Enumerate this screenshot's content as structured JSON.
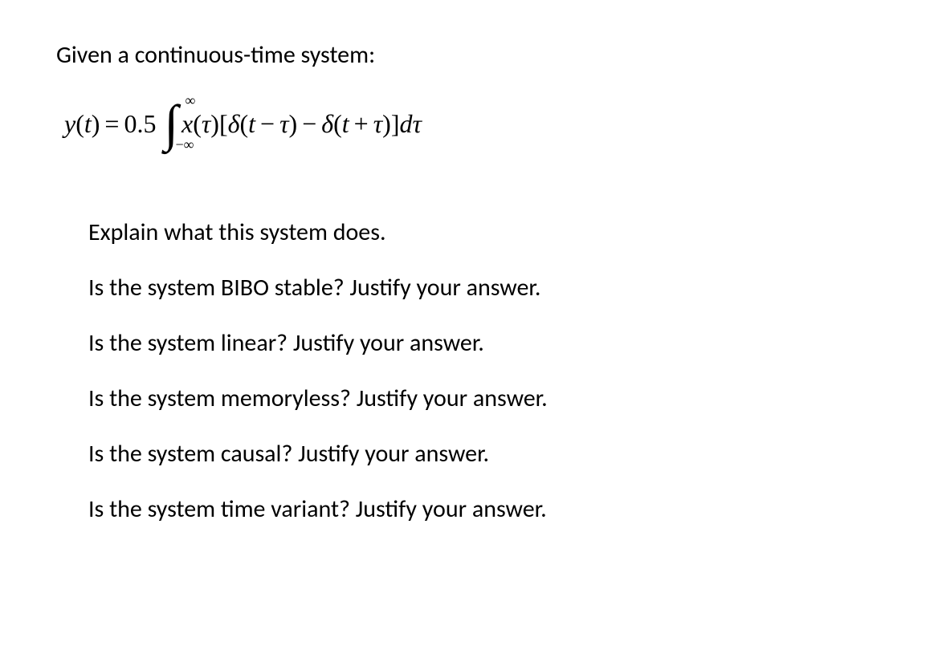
{
  "intro": "Given a continuous-time system:",
  "equation": {
    "lhs_y": "y",
    "lhs_t": "t",
    "equals": "=",
    "coeff": "0.5",
    "int_upper": "∞",
    "int_lower": "−∞",
    "x": "x",
    "tau1": "τ",
    "delta1": "δ",
    "t1": "t",
    "minus": "−",
    "tau2": "τ",
    "delta2": "δ",
    "t2": "t",
    "plus": "+",
    "tau3": "τ",
    "d": "d",
    "tau4": "τ"
  },
  "questions": [
    "Explain what this system does.",
    "Is the system BIBO stable? Justify your answer.",
    "Is the system linear? Justify your answer.",
    "Is the system memoryless? Justify your answer.",
    "Is the system causal? Justify your answer.",
    "Is the system time variant? Justify your answer."
  ]
}
